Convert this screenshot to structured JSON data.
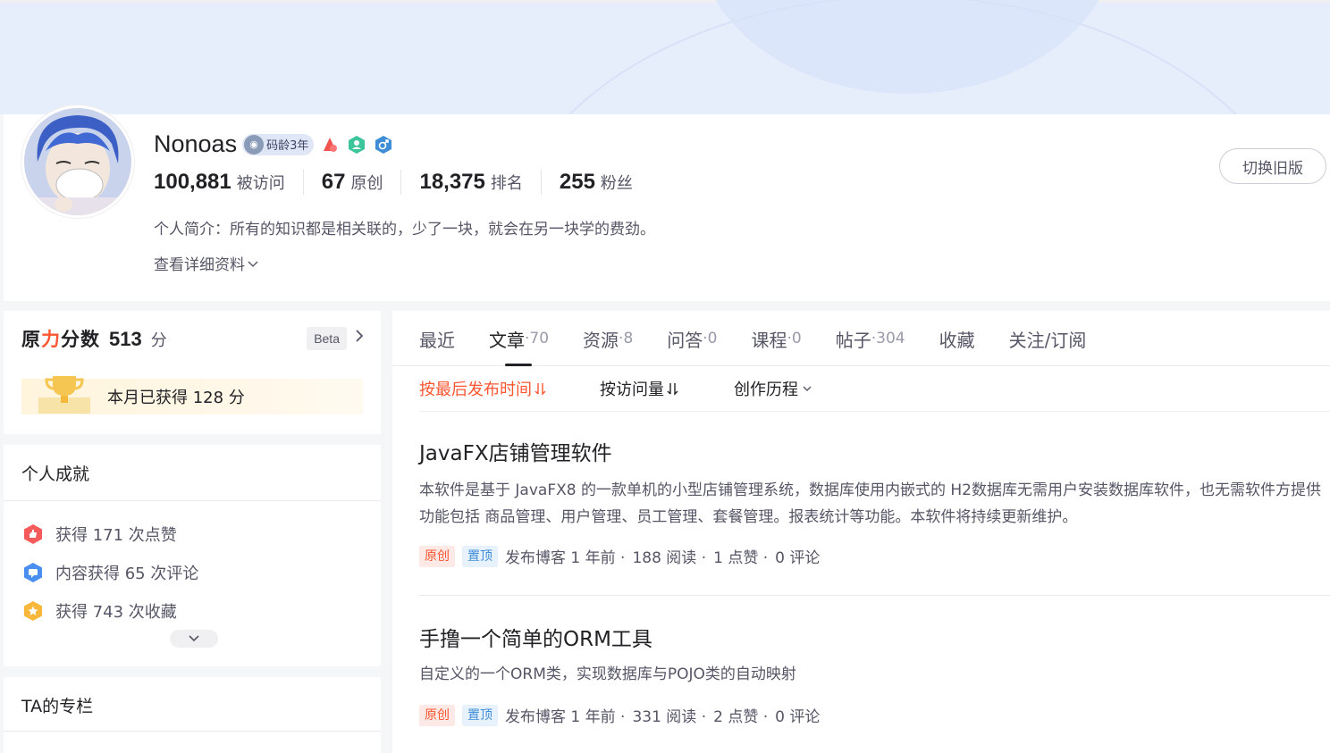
{
  "profile": {
    "name": "Nonoas",
    "code_age": "码龄3年",
    "stats": [
      {
        "num": "100,881",
        "label": "被访问"
      },
      {
        "num": "67",
        "label": "原创"
      },
      {
        "num": "18,375",
        "label": "排名"
      },
      {
        "num": "255",
        "label": "粉丝"
      }
    ],
    "bio": "个人简介：所有的知识都是相关联的，少了一块，就会在另一块学的费劲。",
    "more_info": "查看详细资料",
    "switch_label": "切换旧版"
  },
  "force": {
    "logo_a": "原",
    "logo_b": "力",
    "logo_c": "分数",
    "score": "513",
    "unit": "分",
    "beta": "Beta",
    "month_text": "本月已获得 128 分"
  },
  "achievements": {
    "title": "个人成就",
    "items": [
      {
        "text": "获得 171 次点赞",
        "color": "#f55b5b"
      },
      {
        "text": "内容获得 65 次评论",
        "color": "#4a8ef0"
      },
      {
        "text": "获得 743 次收藏",
        "color": "#f7b73a"
      }
    ]
  },
  "column": {
    "title": "TA的专栏"
  },
  "tabs": [
    {
      "label": "最近",
      "count": ""
    },
    {
      "label": "文章",
      "count": "·70"
    },
    {
      "label": "资源",
      "count": "·8"
    },
    {
      "label": "问答",
      "count": "·0"
    },
    {
      "label": "课程",
      "count": "·0"
    },
    {
      "label": "帖子",
      "count": "·304"
    },
    {
      "label": "收藏",
      "count": ""
    },
    {
      "label": "关注/订阅",
      "count": ""
    }
  ],
  "sorts": [
    {
      "label": "按最后发布时间"
    },
    {
      "label": "按访问量"
    },
    {
      "label": "创作历程"
    }
  ],
  "articles": [
    {
      "title": "JavaFX店铺管理软件",
      "desc_1": "本软件是基于 JavaFX8 的一款单机的小型店铺管理系统，数据库使用内嵌式的 H2数据库无需用户安装数据库软件，也无需软件方提供",
      "desc_2": "功能包括 商品管理、用户管理、员工管理、套餐管理。报表统计等功能。本软件将持续更新维护。",
      "tag_orig": "原创",
      "tag_top": "置顶",
      "published": "发布博客 1 年前 ·",
      "reads": "188 阅读 ·",
      "likes": "1 点赞 ·",
      "comments": "0 评论"
    },
    {
      "title": "手撸一个简单的ORM工具",
      "desc_1": "自定义的一个ORM类，实现数据库与POJO类的自动映射",
      "tag_orig": "原创",
      "tag_top": "置顶",
      "published": "发布博客 1 年前 ·",
      "reads": "331 阅读 ·",
      "likes": "2 点赞 ·",
      "comments": "0 评论"
    }
  ],
  "colors": {
    "accent": "#fc5531",
    "banner": "#e7eefb"
  }
}
